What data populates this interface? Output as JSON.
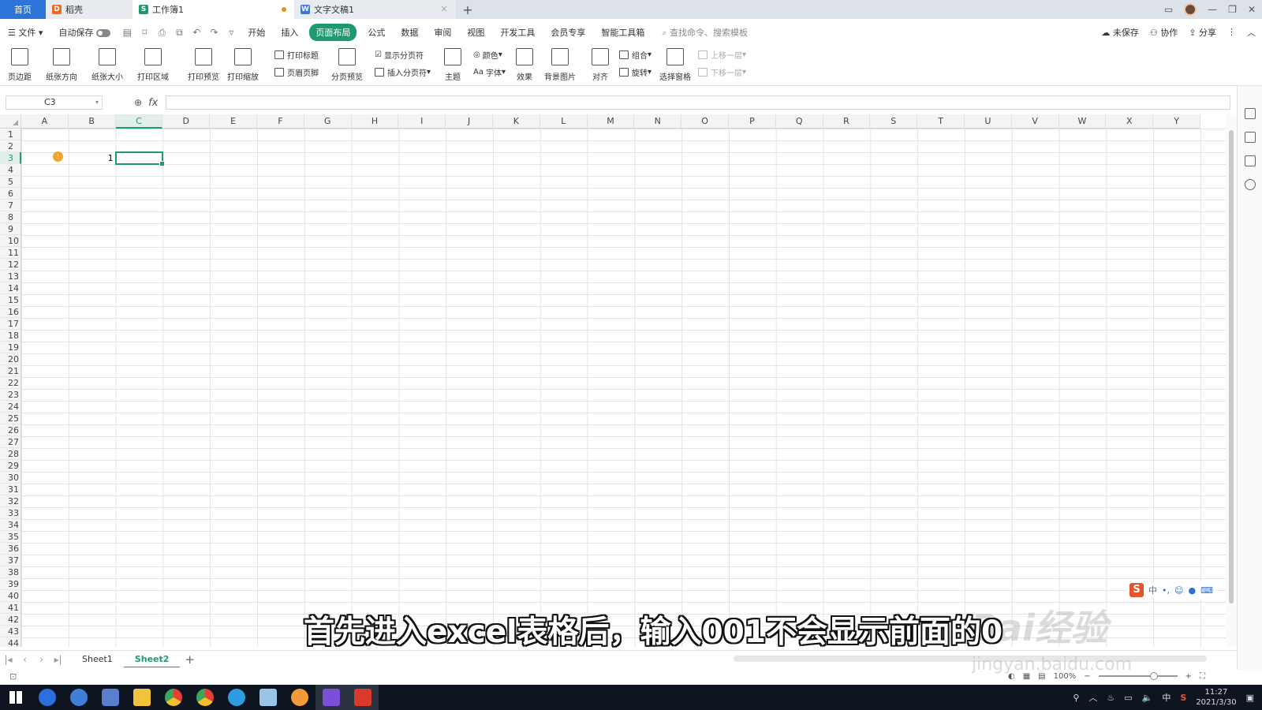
{
  "tabs": {
    "home": "首页",
    "docer": "稻壳",
    "workbook": "工作簿1",
    "word": "文字文稿1",
    "new_tab": "+"
  },
  "menubar": {
    "file": "文件",
    "autosave": "自动保存",
    "items": [
      "开始",
      "插入",
      "页面布局",
      "公式",
      "数据",
      "审阅",
      "视图",
      "开发工具",
      "会员专享",
      "智能工具箱"
    ],
    "active_index": 2,
    "search_placeholder": "查找命令、搜索模板",
    "unsaved": "未保存",
    "collab": "协作",
    "share": "分享"
  },
  "ribbon": {
    "margins": "页边距",
    "orientation": "纸张方向",
    "size": "纸张大小",
    "print_area": "打印区域",
    "print_preview": "打印预览",
    "print_scale": "打印缩放",
    "print_titles": "打印标题",
    "header_footer": "页眉页脚",
    "page_break_preview": "分页预览",
    "show_breaks": "显示分页符",
    "insert_break": "插入分页符",
    "theme": "主题",
    "colors": "颜色",
    "fonts": "字体",
    "effects": "效果",
    "background": "背景图片",
    "align": "对齐",
    "group": "组合",
    "rotate": "旋转",
    "select_pane": "选择窗格",
    "bring_forward": "上移一层",
    "send_backward": "下移一层"
  },
  "formula": {
    "name_box": "C3",
    "fx": "fx",
    "value": ""
  },
  "grid": {
    "columns": [
      "A",
      "B",
      "C",
      "D",
      "E",
      "F",
      "G",
      "H",
      "I",
      "J",
      "K",
      "L",
      "M",
      "N",
      "O",
      "P",
      "Q",
      "R",
      "S",
      "T",
      "U",
      "V",
      "W",
      "X",
      "Y"
    ],
    "selected_col": "C",
    "selected_row": 3,
    "row_count": 44,
    "cells": [
      {
        "ref": "B3",
        "value": "1"
      }
    ]
  },
  "sheets": {
    "tabs": [
      "Sheet1",
      "Sheet2"
    ],
    "active": "Sheet2",
    "add": "+"
  },
  "status": {
    "zoom": "100%"
  },
  "subtitle": "首先进入excel表格后，输入001不会显示前面的0",
  "watermark": {
    "main": "Bai经验",
    "url": "jingyan.baidu.com"
  },
  "ime": {
    "lang": "中"
  },
  "taskbar": {
    "time": "11:27",
    "date": "2021/3/30",
    "lang": "中"
  },
  "colors": {
    "accent": "#1e9b6e",
    "tab_home": "#2d74d8",
    "taskbar": "#0f1520"
  }
}
